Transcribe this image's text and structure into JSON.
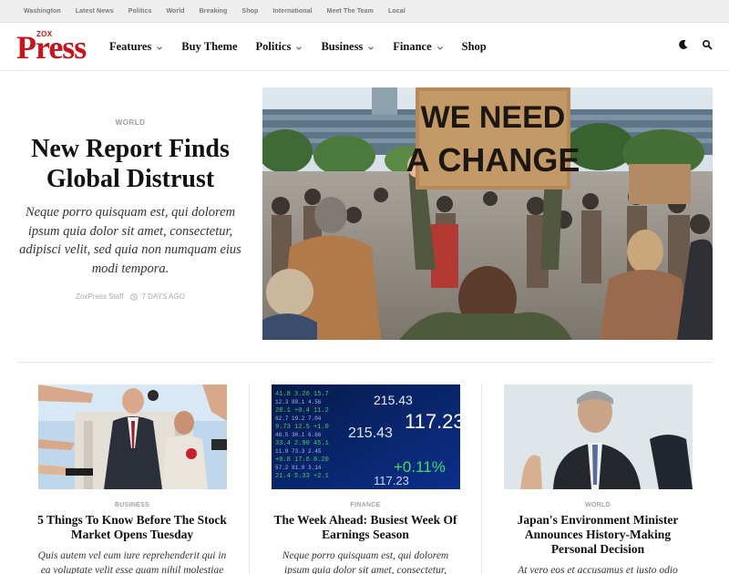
{
  "topbar": {
    "links": [
      "Washington",
      "Latest News",
      "Politics",
      "World",
      "Breaking",
      "Shop",
      "International",
      "Meet The Team",
      "Local"
    ]
  },
  "header": {
    "logo_small": "ZOX",
    "logo_big": "Press",
    "nav": [
      {
        "label": "Features",
        "dropdown": true
      },
      {
        "label": "Buy Theme",
        "dropdown": false
      },
      {
        "label": "Politics",
        "dropdown": true
      },
      {
        "label": "Business",
        "dropdown": true
      },
      {
        "label": "Finance",
        "dropdown": true
      },
      {
        "label": "Shop",
        "dropdown": false
      }
    ],
    "icons": [
      "moon-icon",
      "search-icon"
    ]
  },
  "hero": {
    "category": "WORLD",
    "title": "New Report Finds Global Distrust",
    "excerpt": "Neque porro quisquam est, qui dolorem ipsum quia dolor sit amet, consectetur, adipisci velit, sed quia non numquam eius modi tempora.",
    "author": "ZoxPress Staff",
    "time": "7 DAYS AGO",
    "sign_line1": "WE NEED",
    "sign_line2": "A CHANGE"
  },
  "cards": [
    {
      "category": "BUSINESS",
      "title": "5 Things To Know Before The Stock Market Opens Tuesday",
      "excerpt": "Quis autem vel eum iure reprehenderit qui in ea voluptate velit esse quam nihil molestiae"
    },
    {
      "category": "FINANCE",
      "title": "The Week Ahead: Busiest Week Of Earnings Season",
      "excerpt": "Neque porro quisquam est, qui dolorem ipsum quia dolor sit amet, consectetur,",
      "ticker": [
        "117.23",
        "215.43",
        "+0.11%",
        "117.23",
        "215.43"
      ]
    },
    {
      "category": "WORLD",
      "title": "Japan's Environment Minister Announces History-Making Personal Decision",
      "excerpt": "At vero eos et accusamus et iusto odio"
    }
  ],
  "colors": {
    "brand": "#c4161c",
    "topbar_bg": "#eeeeee"
  }
}
